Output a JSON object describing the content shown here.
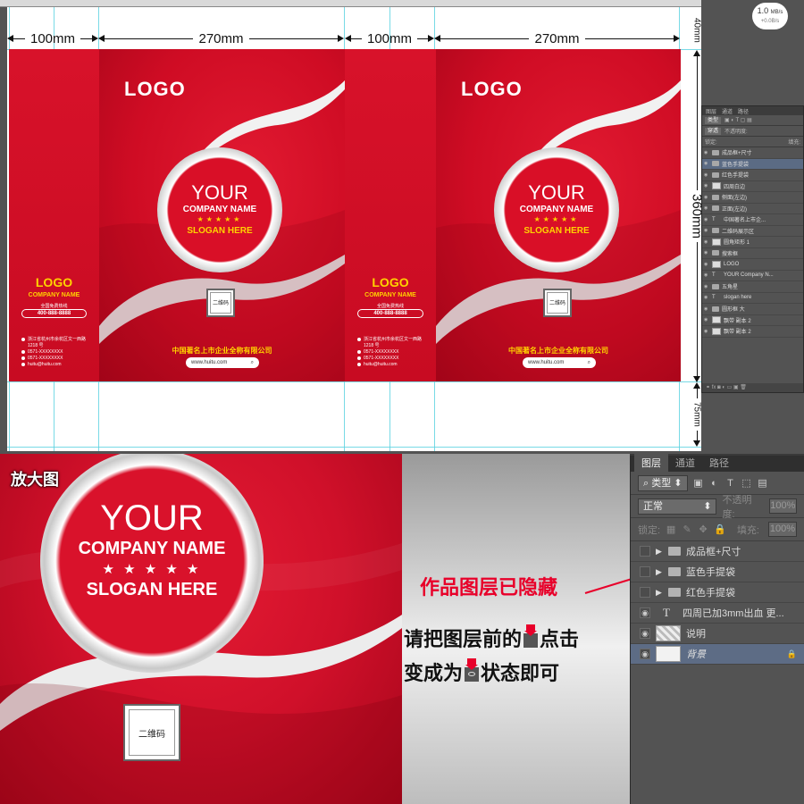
{
  "zoom": {
    "value": "1.0",
    "unit": "MB/s",
    "sub": "+0.0B/s"
  },
  "dimensions": {
    "side_width": "100mm",
    "front_width": "270mm",
    "height": "360mm",
    "top_margin": "40mm",
    "bottom_margin": "75mm"
  },
  "front": {
    "logo": "LOGO",
    "your": "YOUR",
    "company": "COMPANY NAME",
    "stars": "★★★★★",
    "slogan": "SLOGAN HERE",
    "qr_label": "二维码",
    "company_cn": "中国著名上市企业全称有限公司",
    "url": "www.huitu.com",
    "search_icon": "search-icon"
  },
  "side": {
    "logo": "LOGO",
    "company": "COMPANY NAME",
    "hotline_label": "全国免费热线",
    "hotline": "400-888-8888",
    "address": "浙江省杭州市余杭区文一西路 1218 号",
    "phone1": "0571-XXXXXXXX",
    "phone2": "0571-XXXXXXXX",
    "email": "huitu@huitu.com"
  },
  "small_layers": {
    "tabs": [
      "图层",
      "通道",
      "路径"
    ],
    "kind": "类型",
    "blend": "穿透",
    "opacity_label": "不透明度:",
    "lock_label": "锁定:",
    "fill_label": "填充:",
    "rows": [
      {
        "name": "成品框+尺寸",
        "type": "folder"
      },
      {
        "name": "蓝色手提袋",
        "type": "folder",
        "selected": true
      },
      {
        "name": "红色手提袋",
        "type": "folder"
      },
      {
        "name": "四周白边",
        "type": "layer"
      },
      {
        "name": "侧面(左边)",
        "type": "folder"
      },
      {
        "name": "正面(左边)",
        "type": "folder"
      },
      {
        "name": "中国著名上市企...",
        "type": "text"
      },
      {
        "name": "二维码展示区",
        "type": "folder"
      },
      {
        "name": "圆角矩形 1",
        "type": "layer"
      },
      {
        "name": "搜索框",
        "type": "folder"
      },
      {
        "name": "LOGO",
        "type": "layer"
      },
      {
        "name": "YOUR Company N...",
        "type": "text"
      },
      {
        "name": "五角星",
        "type": "folder"
      },
      {
        "name": "slogan here",
        "type": "text"
      },
      {
        "name": "圆形框 大",
        "type": "folder"
      },
      {
        "name": "飘带 副本 2",
        "type": "layer"
      },
      {
        "name": "飘带 副本 2",
        "type": "layer"
      }
    ]
  },
  "zoom_view": {
    "title": "放大图",
    "your": "YOUR",
    "company": "COMPANY NAME",
    "stars": "★ ★ ★ ★ ★",
    "slogan": "SLOGAN HERE",
    "qr_label": "二维码"
  },
  "notes": {
    "line1": "作品图层已隐藏",
    "line2a": "请把图层前的",
    "line2b": "点击",
    "line3a": "变成为",
    "line3b": "状态即可"
  },
  "layers_panel": {
    "tabs": [
      "图层",
      "通道",
      "路径"
    ],
    "kind": "类型",
    "blend_mode": "正常",
    "opacity_label": "不透明度:",
    "opacity_value": "100%",
    "lock_label": "锁定:",
    "fill_label": "填充:",
    "fill_value": "100%",
    "layers": [
      {
        "name": "成品框+尺寸",
        "kind": "folder",
        "visible": false
      },
      {
        "name": "蓝色手提袋",
        "kind": "folder",
        "visible": false
      },
      {
        "name": "红色手提袋",
        "kind": "folder",
        "visible": false
      },
      {
        "name": "四周已加3mm出血 更...",
        "kind": "text",
        "visible": true
      },
      {
        "name": "说明",
        "kind": "image",
        "visible": true
      },
      {
        "name": "背景",
        "kind": "background",
        "visible": true,
        "selected": true,
        "locked": true
      }
    ]
  },
  "colors": {
    "brand_red": "#d40f28",
    "accent_yellow": "#ffd200",
    "note_red": "#e8002a"
  }
}
